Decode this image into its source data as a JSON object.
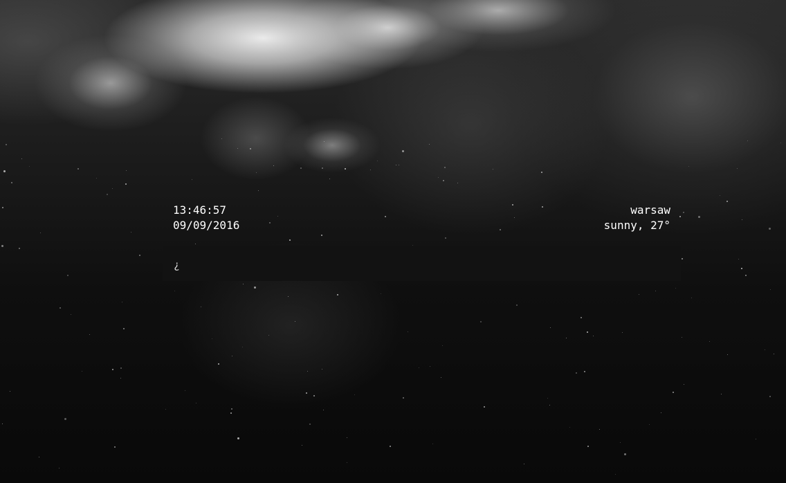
{
  "clock": {
    "time": "13:46:57",
    "date": "09/09/2016"
  },
  "weather": {
    "city": "warsaw",
    "condition": "sunny, 27°"
  },
  "prompt": {
    "symbol": "¿",
    "value": "",
    "placeholder": ""
  },
  "theme": {
    "text_color": "#ffffff",
    "prompt_background": "#121212"
  }
}
